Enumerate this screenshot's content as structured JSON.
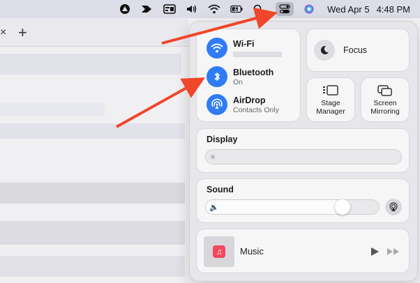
{
  "menubar": {
    "icons": [
      "vpn-icon",
      "arrow-app-icon",
      "card-icon",
      "volume-icon",
      "wifi-icon",
      "battery-icon",
      "search-icon",
      "control-center-icon",
      "siri-icon"
    ],
    "date": "Wed Apr 5",
    "time": "4:48 PM"
  },
  "browser": {
    "close_glyph": "×",
    "add_glyph": "+"
  },
  "control_center": {
    "wifi": {
      "title": "Wi-Fi"
    },
    "bluetooth": {
      "title": "Bluetooth",
      "status": "On"
    },
    "airdrop": {
      "title": "AirDrop",
      "status": "Contacts Only"
    },
    "focus": {
      "label": "Focus"
    },
    "stage_manager": {
      "label": "Stage Manager"
    },
    "screen_mirroring": {
      "label": "Screen Mirroring"
    },
    "display": {
      "title": "Display",
      "brightness_fraction": 0.0
    },
    "sound": {
      "title": "Sound",
      "volume_fraction": 0.82
    },
    "music": {
      "label": "Music"
    }
  },
  "colors": {
    "accent_blue": "#2f7cf6",
    "annotation_arrow": "#f0462a",
    "music_red": "#f3485e"
  }
}
